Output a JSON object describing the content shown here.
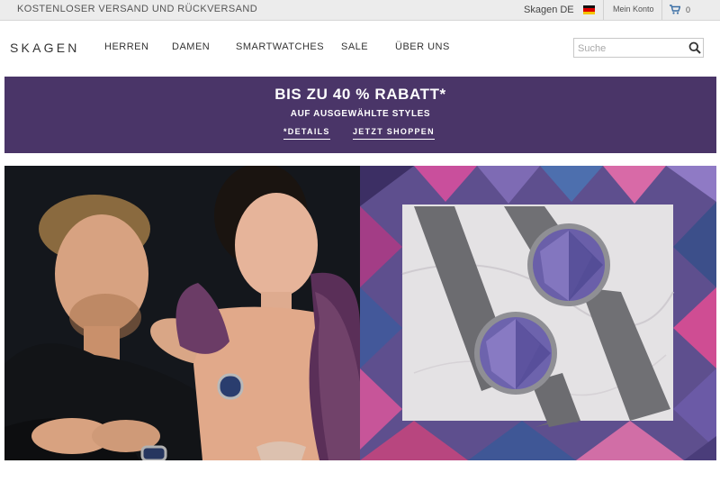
{
  "topbar": {
    "promo": "KOSTENLOSER VERSAND UND RÜCKVERSAND",
    "region": "Skagen DE",
    "account": "Mein Konto",
    "cart_count": "0"
  },
  "header": {
    "logo": "SKAGEN",
    "nav": [
      "HERREN",
      "DAMEN",
      "SMARTWATCHES",
      "SALE",
      "ÜBER UNS"
    ]
  },
  "search": {
    "placeholder": "Suche",
    "value": ""
  },
  "banner": {
    "headline": "BIS ZU 40 % RABATT*",
    "subline": "AUF AUSGEWÄHLTE STYLES",
    "details_link": "*DETAILS",
    "shop_link": "JETZT SHOPPEN"
  },
  "colors": {
    "banner_bg": "#4a3568",
    "topbar_bg": "#ececec",
    "text": "#333333"
  },
  "icons": {
    "flag": "germany-flag-icon",
    "cart": "cart-icon",
    "search": "search-icon"
  }
}
